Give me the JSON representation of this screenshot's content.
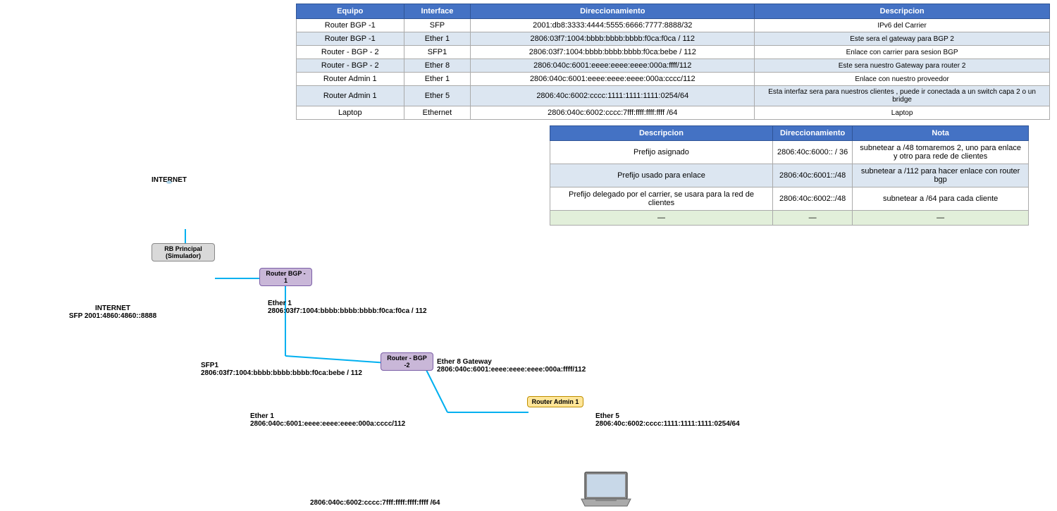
{
  "tables": {
    "main": {
      "headers": [
        "Equipo",
        "Interface",
        "Direccionamiento",
        "Descripcion"
      ],
      "rows": [
        [
          "Router BGP -1",
          "SFP",
          "2001:db8:3333:4444:5555:6666:7777:8888/32",
          "IPv6 del Carrier"
        ],
        [
          "Router BGP -1",
          "Ether 1",
          "2806:03f7:1004:bbbb:bbbb:bbbb:f0ca:f0ca / 112",
          "Este sera el gateway para BGP 2"
        ],
        [
          "Router - BGP - 2",
          "SFP1",
          "2806:03f7:1004:bbbb:bbbb:bbbb:f0ca:bebe / 112",
          "Enlace con carrier para sesion BGP"
        ],
        [
          "Router - BGP - 2",
          "Ether 8",
          "2806:040c:6001:eeee:eeee:eeee:000a:ffff/112",
          "Este sera nuestro Gateway para router 2"
        ],
        [
          "Router Admin 1",
          "Ether 1",
          "2806:040c:6001:eeee:eeee:eeee:000a:cccc/112",
          "Enlace con nuestro proveedor"
        ],
        [
          "Router Admin 1",
          "Ether 5",
          "2806:40c:6002:cccc:1111:1111:1111:0254/64",
          "Esta interfaz sera para nuestros clientes , puede ir conectada a un switch capa 2 o un bridge"
        ],
        [
          "Laptop",
          "Ethernet",
          "2806:040c:6002:cccc:7fff:ffff:ffff:ffff /64",
          "Laptop"
        ]
      ]
    },
    "second": {
      "headers": [
        "Descripcion",
        "Direccionamiento",
        "Nota"
      ],
      "rows": [
        [
          "Prefijo asignado",
          "2806:40c:6000:: / 36",
          "subnetear a /48  tomaremos 2, uno para enlace y otro para rede de clientes"
        ],
        [
          "Prefijo usado para enlace",
          "2806:40c:6001::/48",
          "subnetear a /112 para hacer enlace con router bgp"
        ],
        [
          "Prefijo delegado por el carrier, se usara para la red de clientes",
          "2806:40c:6002::/48",
          "subnetear a /64 para cada cliente"
        ],
        [
          "—",
          "—",
          "—"
        ]
      ]
    }
  },
  "diagram": {
    "internet": {
      "label": "INTERNET",
      "sfp_label": "INTERNET\nSFP 2001:4860:4860::8888",
      "sfp_text": "INTERNET",
      "sfp_addr": "SFP 2001:4860:4860::8888"
    },
    "rb_principal": {
      "line1": "RB Principal",
      "line2": "(Simulador)"
    },
    "router_bgp": {
      "line1": "Router BGP -",
      "line2": "1"
    },
    "ether1_bgp": {
      "label": "Ether 1",
      "addr": "2806:03f7:1004:bbbb:bbbb:bbbb:f0ca:f0ca / 112"
    },
    "sfp1": {
      "label": "SFP1",
      "addr": "2806:03f7:1004:bbbb:bbbb:bbbb:f0ca:bebe / 112"
    },
    "router_bgp2": {
      "label": "Router - BGP -2"
    },
    "ether8": {
      "label": "Ether 8 Gateway",
      "addr": "2806:040c:6001:eeee:eeee:eeee:000a:ffff/112"
    },
    "router_admin": {
      "label": "Router Admin 1"
    },
    "ether1_admin": {
      "label": "Ether 1",
      "addr": "2806:040c:6001:eeee:eeee:eeee:000a:cccc/112"
    },
    "ether5": {
      "label": "Ether 5",
      "addr": "2806:40c:6002:cccc:1111:1111:1111:0254/64"
    },
    "laptop": {
      "label": "2806:040c:6002:cccc:7fff:ffff:ffff:ffff /64"
    }
  },
  "colors": {
    "header_bg": "#4472c4",
    "header_text": "#ffffff",
    "row_even": "#dce6f1",
    "row_odd": "#ffffff",
    "last_row": "#e2efda",
    "router_bgp_box": "#c9b7d8",
    "router_admin_box": "#ffe699",
    "rb_box": "#d9d9d9"
  }
}
